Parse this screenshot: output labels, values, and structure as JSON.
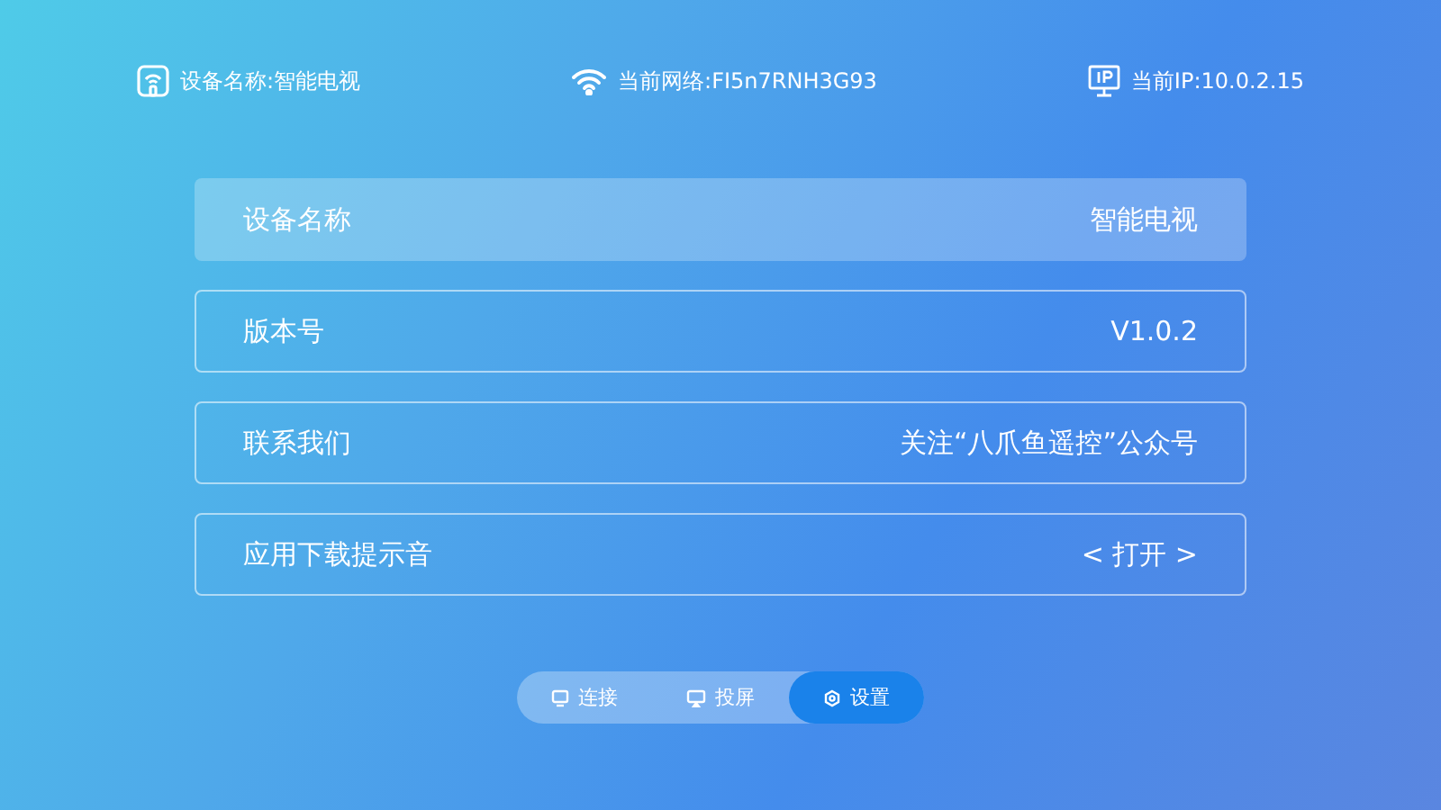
{
  "status_bar": {
    "device": "设备名称:智能电视",
    "network": "当前网络:FI5n7RNH3G93",
    "ip": "当前IP:10.0.2.15"
  },
  "settings": [
    {
      "label": "设备名称",
      "value": "智能电视",
      "selected": true
    },
    {
      "label": "版本号",
      "value": "V1.0.2",
      "selected": false
    },
    {
      "label": "联系我们",
      "value": "关注“八爪鱼遥控”公众号",
      "selected": false
    },
    {
      "label": "应用下载提示音",
      "value": "< 打开 >",
      "selected": false
    }
  ],
  "tabs": [
    {
      "label": "连接",
      "kind": "connect",
      "selected": false
    },
    {
      "label": "投屏",
      "kind": "cast",
      "selected": false
    },
    {
      "label": "设置",
      "kind": "settings",
      "selected": true
    }
  ]
}
